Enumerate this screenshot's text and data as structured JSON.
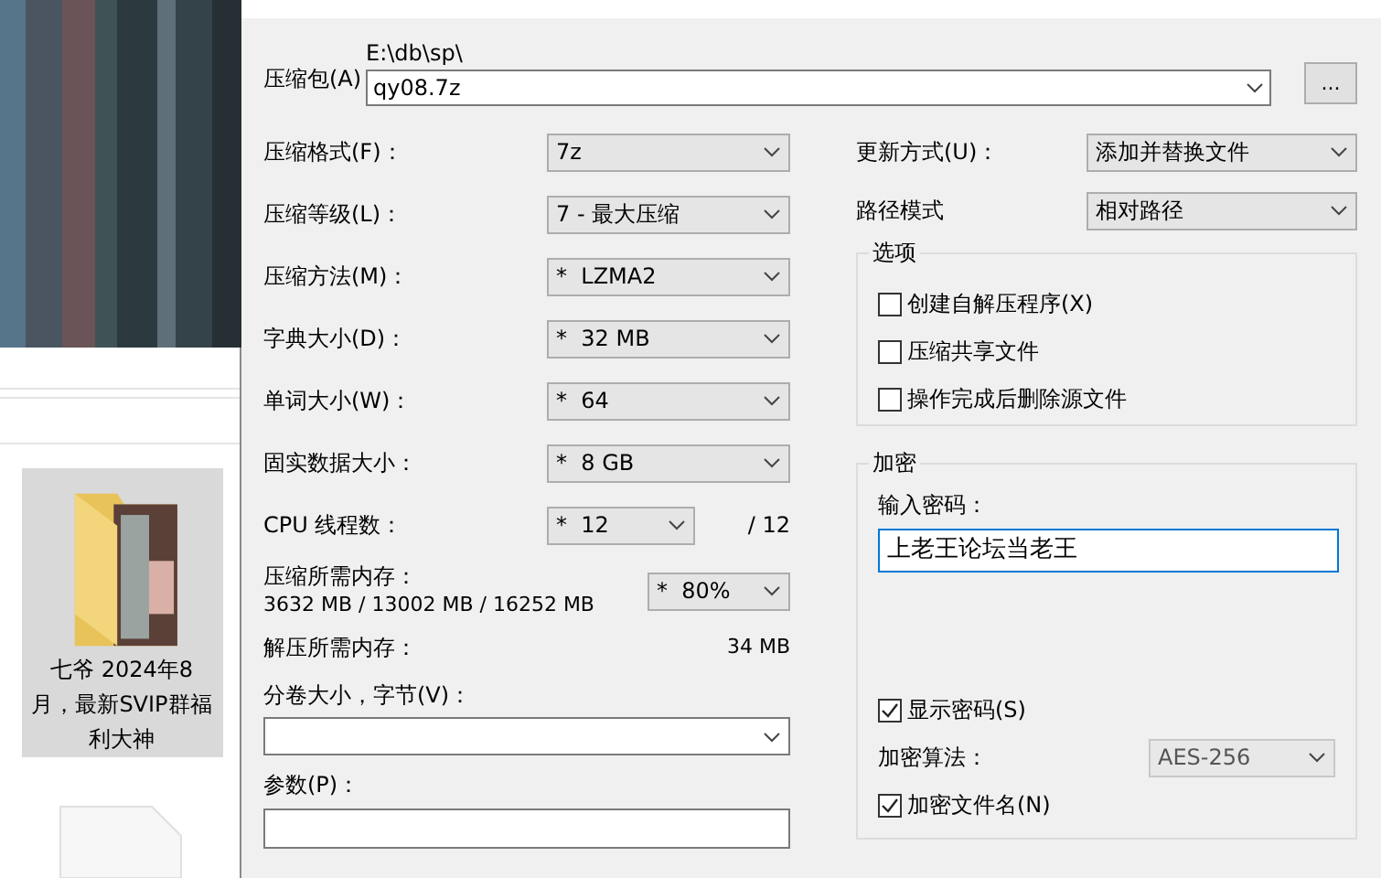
{
  "background": {
    "folder": {
      "label": "七爷 2024年8月，最新SVIP群福利大神",
      "selected": true
    }
  },
  "archive": {
    "label": "压缩包(A)",
    "path": "E:\\db\\sp\\",
    "value": "qy08.7z",
    "browse": "..."
  },
  "left_fields": [
    {
      "kind": "select",
      "label": "压缩格式(F)：",
      "value": "7z"
    },
    {
      "kind": "select",
      "label": "压缩等级(L)：",
      "value": "7 - 最大压缩"
    },
    {
      "kind": "select",
      "label": "压缩方法(M)：",
      "value": "*  LZMA2"
    },
    {
      "kind": "select",
      "label": "字典大小(D)：",
      "value": "*  32 MB"
    },
    {
      "kind": "select",
      "label": "单词大小(W)：",
      "value": "*  64"
    },
    {
      "kind": "select",
      "label": "固实数据大小：",
      "value": "*  8 GB"
    },
    {
      "kind": "short_select",
      "label": "CPU 线程数：",
      "value": "*  12",
      "suffix": "/ 12"
    }
  ],
  "memory": {
    "label": "压缩所需内存：",
    "values": "3632 MB / 13002 MB / 16252 MB",
    "value": "*  80%"
  },
  "decompress": {
    "label": "解压所需内存：",
    "value": "34 MB"
  },
  "split": {
    "label": "分卷大小，字节(V)："
  },
  "params": {
    "label": "参数(P)："
  },
  "update": {
    "label": "更新方式(U)：",
    "value": "添加并替换文件"
  },
  "path_mode": {
    "label": "路径模式",
    "value": "相对路径"
  },
  "options": {
    "title": "选项",
    "items": [
      {
        "label": "创建自解压程序(X)",
        "checked": false
      },
      {
        "label": "压缩共享文件",
        "checked": false
      },
      {
        "label": "操作完成后删除源文件",
        "checked": false
      }
    ]
  },
  "encryption": {
    "title": "加密",
    "password_label": "输入密码：",
    "password": "上老王论坛当老王",
    "show_password": {
      "label": "显示密码(S)",
      "checked": true
    },
    "method_label": "加密算法：",
    "method": "AES-256",
    "encrypt_names": {
      "label": "加密文件名(N)",
      "checked": true
    }
  }
}
